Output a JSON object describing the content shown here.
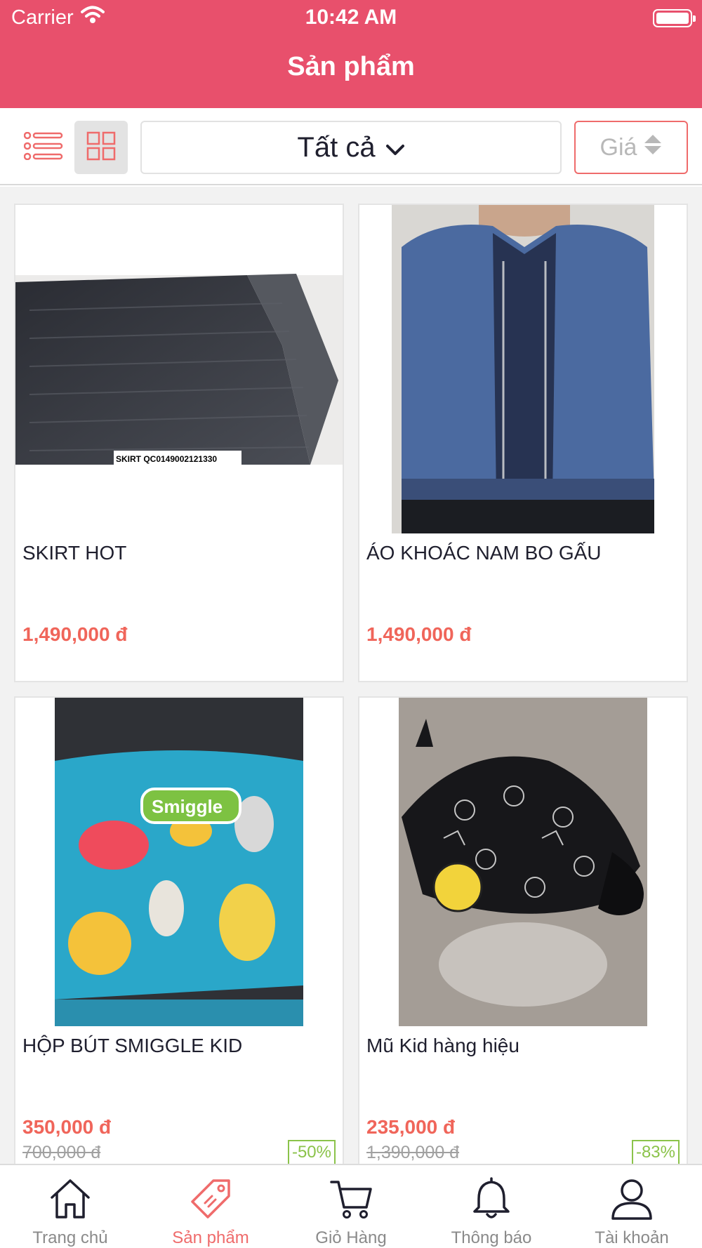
{
  "status_bar": {
    "carrier": "Carrier",
    "time": "10:42 AM"
  },
  "header": {
    "title": "Sản phẩm"
  },
  "toolbar": {
    "category": "Tất cả",
    "sort_label": "Giá"
  },
  "products": [
    {
      "name": "SKIRT HOT",
      "price": "1,490,000 đ",
      "old_price": "",
      "discount": "",
      "image_label": "SKIRT QC0149002121330"
    },
    {
      "name": "ÁO KHOÁC  NAM BO GẤU",
      "price": "1,490,000 đ",
      "old_price": "",
      "discount": ""
    },
    {
      "name": "HỘP BÚT SMIGGLE KID",
      "price": "350,000 đ",
      "old_price": "700,000 đ",
      "discount": "-50%"
    },
    {
      "name": "Mũ Kid hàng hiệu",
      "price": "235,000 đ",
      "old_price": "1,390,000 đ",
      "discount": "-83%"
    }
  ],
  "tabbar": {
    "home": "Trang chủ",
    "products": "Sản phẩm",
    "cart": "Giỏ Hàng",
    "notifications": "Thông báo",
    "account": "Tài khoản"
  },
  "colors": {
    "brand": "#e8506c",
    "price": "#f0655a",
    "discount": "#8bc34a",
    "active_tab": "#ef6b6b"
  }
}
